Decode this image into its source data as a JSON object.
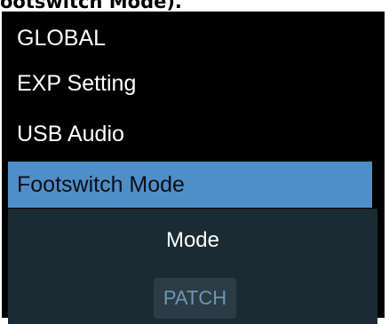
{
  "caption": "ootswitch Mode).",
  "menu": {
    "header": "GLOBAL",
    "items": [
      {
        "label": "EXP Setting"
      },
      {
        "label": "USB Audio"
      },
      {
        "label": "Footswitch Mode"
      }
    ],
    "selected_index": 2
  },
  "panel": {
    "label": "Mode",
    "value": "PATCH"
  },
  "colors": {
    "selection": "#4f8fc9",
    "panel_bg": "#1a2b33",
    "value_box_bg": "#2b3c46",
    "value_text": "#6f96b4"
  }
}
